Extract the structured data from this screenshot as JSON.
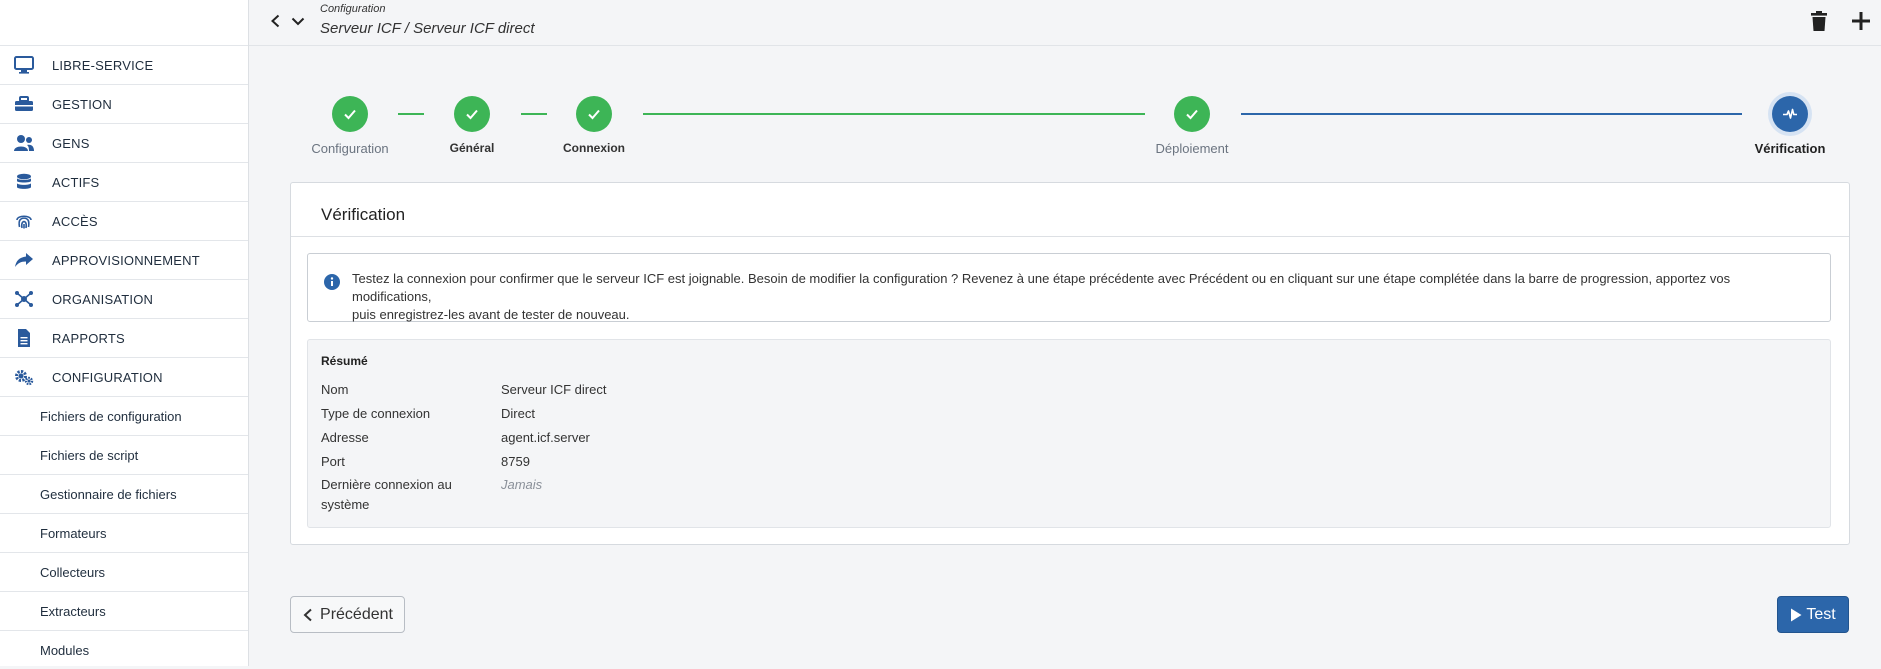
{
  "header": {
    "crumb_small": "Configuration",
    "crumb_main": "Serveur ICF / Serveur ICF direct"
  },
  "sidebar": {
    "items": [
      {
        "label": "LIBRE-SERVICE",
        "icon": "monitor-icon"
      },
      {
        "label": "GESTION",
        "icon": "toolbox-icon"
      },
      {
        "label": "GENS",
        "icon": "people-icon"
      },
      {
        "label": "ACTIFS",
        "icon": "database-icon"
      },
      {
        "label": "ACCÈS",
        "icon": "fingerprint-icon"
      },
      {
        "label": "APPROVISIONNEMENT",
        "icon": "share-icon"
      },
      {
        "label": "ORGANISATION",
        "icon": "network-icon"
      },
      {
        "label": "RAPPORTS",
        "icon": "document-icon"
      },
      {
        "label": "CONFIGURATION",
        "icon": "gears-icon"
      }
    ],
    "sub_items": [
      "Fichiers de configuration",
      "Fichiers de script",
      "Gestionnaire de fichiers",
      "Formateurs",
      "Collecteurs",
      "Extracteurs",
      "Modules"
    ]
  },
  "stepper": {
    "steps": [
      {
        "label": "Configuration",
        "state": "completed"
      },
      {
        "label": "Général",
        "state": "completed"
      },
      {
        "label": "Connexion",
        "state": "completed"
      },
      {
        "label": "Déploiement",
        "state": "completed"
      },
      {
        "label": "Vérification",
        "state": "active"
      }
    ]
  },
  "card": {
    "title": "Vérification",
    "info_line1": "Testez la connexion pour confirmer que le serveur ICF est joignable. Besoin de modifier la configuration ? Revenez à une étape précédente avec Précédent ou en cliquant sur une étape complétée dans la barre de progression, apportez vos modifications,",
    "info_line2": "puis enregistrez-les avant de tester de nouveau.",
    "summary": {
      "title": "Résumé",
      "rows": [
        {
          "key": "Nom",
          "value": "Serveur ICF direct"
        },
        {
          "key": "Type de connexion",
          "value": "Direct"
        },
        {
          "key": "Adresse",
          "value": "agent.icf.server"
        },
        {
          "key": "Port",
          "value": "8759"
        },
        {
          "key": "Dernière connexion au système",
          "value": "Jamais"
        }
      ]
    }
  },
  "buttons": {
    "previous": "Précédent",
    "test": "Test"
  },
  "colors": {
    "completed": "#3db556",
    "active": "#2c66aa",
    "primary_button": "#2c66aa"
  }
}
